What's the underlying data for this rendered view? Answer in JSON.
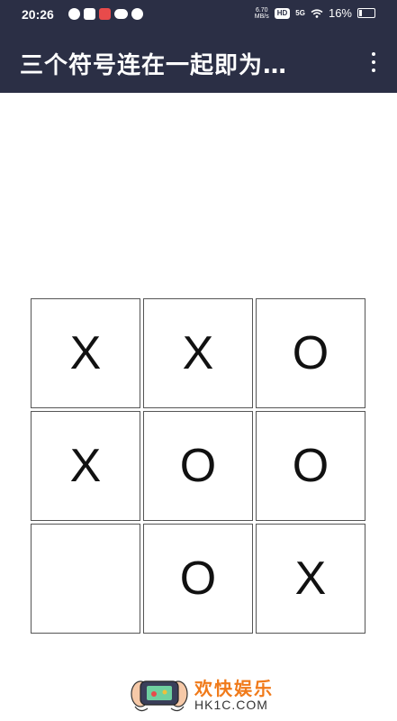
{
  "status_bar": {
    "time": "20:26",
    "net_speed_value": "6.70",
    "net_speed_unit": "MB/s",
    "hd": "HD",
    "network": "5G",
    "battery": "16%",
    "battery_level": 0.16
  },
  "app_bar": {
    "title": "三个符号连在一起即为…"
  },
  "board": {
    "cells": [
      "X",
      "X",
      "O",
      "X",
      "O",
      "O",
      "",
      "O",
      "X"
    ]
  },
  "watermark": {
    "name": "欢快娱乐",
    "site": "HK1C.COM"
  }
}
